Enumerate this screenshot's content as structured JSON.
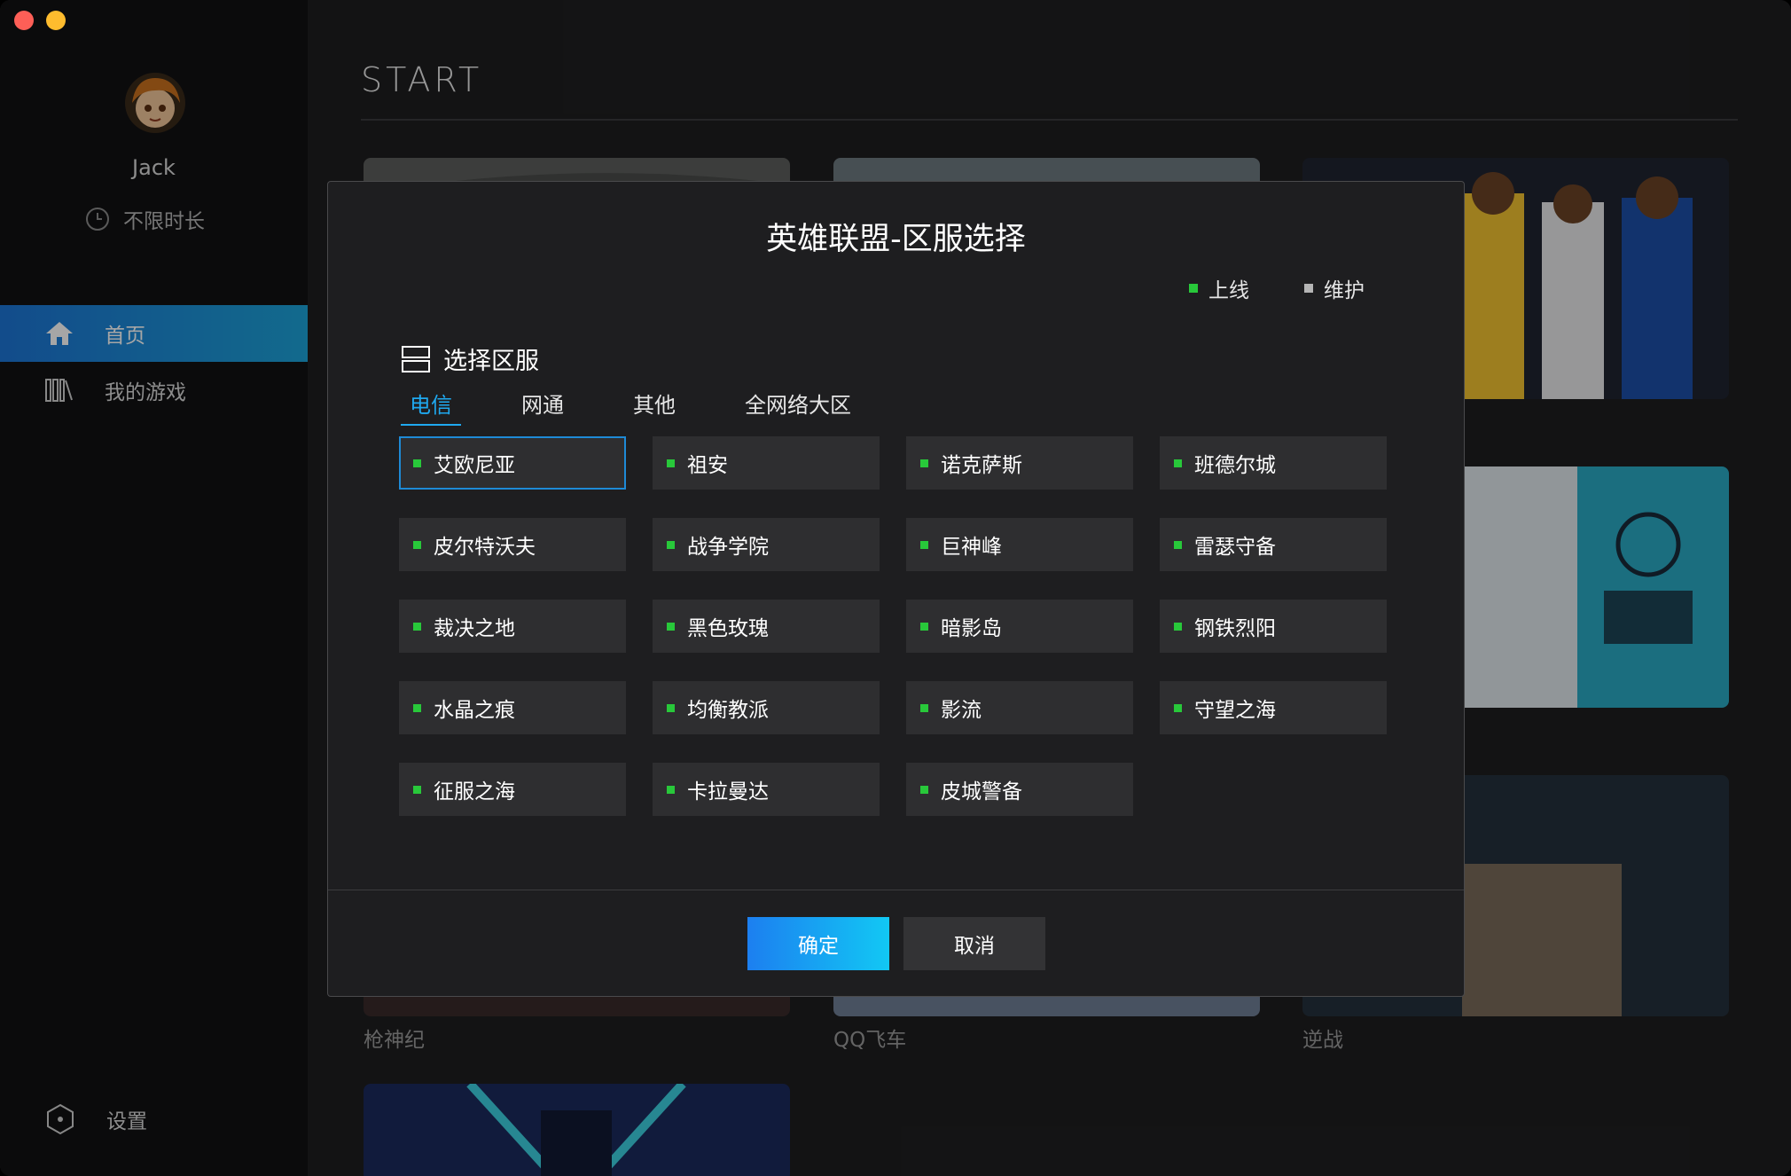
{
  "window": {
    "controls": [
      "close",
      "minimize"
    ]
  },
  "user": {
    "name": "Jack",
    "duration": "不限时长",
    "avatar_icon": "avatar-icon"
  },
  "sidebar": {
    "items": [
      {
        "label": "首页",
        "icon": "home-icon",
        "active": true
      },
      {
        "label": "我的游戏",
        "icon": "library-icon",
        "active": false
      }
    ],
    "settings_label": "设置"
  },
  "main": {
    "title": "START",
    "games": [
      {
        "name": "枪神纪"
      },
      {
        "name": "QQ飞车"
      },
      {
        "name": "逆战"
      }
    ]
  },
  "dialog": {
    "title": "英雄联盟-区服选择",
    "legend": {
      "online": "上线",
      "maintenance": "维护"
    },
    "section_title": "选择区服",
    "tabs": [
      "电信",
      "网通",
      "其他",
      "全网络大区"
    ],
    "active_tab": 0,
    "servers": [
      "艾欧尼亚",
      "祖安",
      "诺克萨斯",
      "班德尔城",
      "皮尔特沃夫",
      "战争学院",
      "巨神峰",
      "雷瑟守备",
      "裁决之地",
      "黑色玫瑰",
      "暗影岛",
      "钢铁烈阳",
      "水晶之痕",
      "均衡教派",
      "影流",
      "守望之海",
      "征服之海",
      "卡拉曼达",
      "皮城警备"
    ],
    "selected_server": 0,
    "confirm_label": "确定",
    "cancel_label": "取消"
  },
  "colors": {
    "accent": "#1fa9f0",
    "online": "#28c83a",
    "maintenance": "#b5b5b5",
    "sidebar_active": "#1d75d6"
  }
}
